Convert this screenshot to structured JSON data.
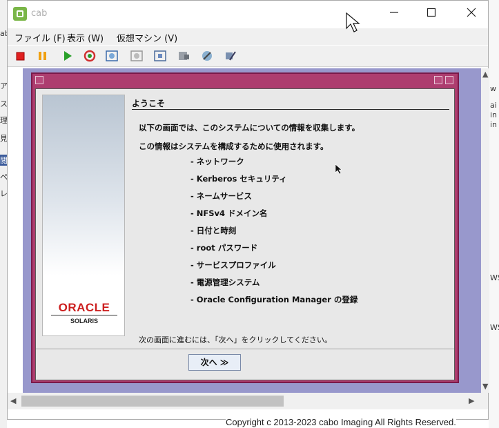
{
  "window": {
    "title": "cab"
  },
  "menu": {
    "file": "ファイル (F)",
    "view": "表示 (W)",
    "vm": "仮想マシン (V)"
  },
  "toolbar_icons": [
    "stop-icon",
    "pause-icon",
    "play-icon",
    "refresh-icon",
    "snapshot-icon",
    "snapshot-revert-icon",
    "snapshot-manager-icon",
    "settings-icon",
    "tools-icon",
    "wrench-icon"
  ],
  "dialog": {
    "heading": "ようこそ",
    "intro1": "以下の画面では、このシステムについての情報を収集します。",
    "intro2": "この情報はシステムを構成するために使用されます。",
    "items": [
      "- ネットワーク",
      "- Kerberos セキュリティ",
      "- ネームサービス",
      "- NFSv4 ドメイン名",
      "- 日付と時刻",
      "- root パスワード",
      "- サービスプロファイル",
      "- 電源管理システム",
      "- Oracle Configuration Manager の登録"
    ],
    "footer": "次の画面に進むには、「次へ」をクリックしてください。",
    "next_label": "次へ ≫",
    "logo_brand": "ORACLE",
    "logo_product": "SOLARIS"
  },
  "background": {
    "left_chars": [
      "ab",
      "ア",
      "ス",
      "理",
      "見",
      "閲",
      "ペ",
      "レ"
    ],
    "right_chars": [
      "w",
      "ai",
      "in",
      "in",
      "WS",
      "WS"
    ]
  },
  "copyright": "Copyright c 2013-2023 cabo Imaging All Rights Reserved.",
  "colors": {
    "dialog_frame": "#ad3d6f",
    "vm_background": "#9898cc",
    "oracle_red": "#cc1f1f"
  }
}
